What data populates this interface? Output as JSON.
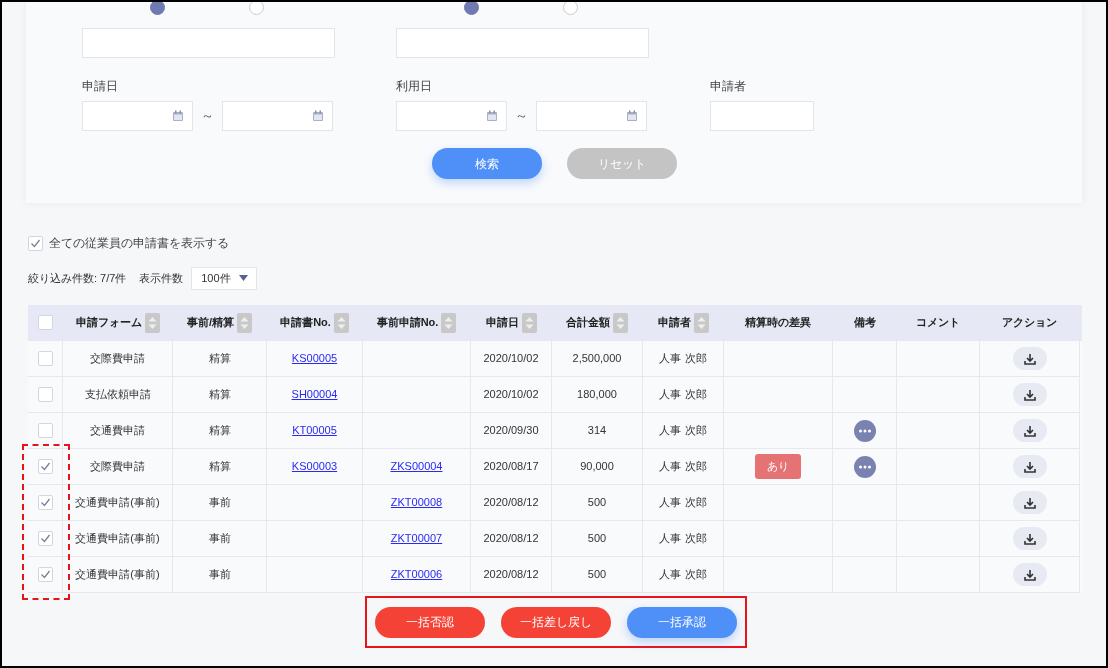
{
  "filters": {
    "number_fields": [
      {
        "radios": [
          {
            "selected": true
          },
          {
            "selected": false
          }
        ]
      },
      {
        "radios": [
          {
            "selected": true
          },
          {
            "selected": false
          }
        ]
      }
    ],
    "date_ranges": [
      {
        "label": "申請日",
        "separator": "～"
      },
      {
        "label": "利用日",
        "separator": "～"
      }
    ],
    "applicant": {
      "label": "申請者"
    },
    "buttons": [
      {
        "label": "検索",
        "kind": "primary"
      },
      {
        "label": "リセット",
        "kind": "secondary"
      }
    ]
  },
  "show_all": {
    "label": "全ての従業員の申請書を表示する",
    "checked": true
  },
  "count_text": "絞り込み件数: 7/7件",
  "page_size": {
    "label": "表示件数",
    "value": "100件"
  },
  "table": {
    "select_all": {
      "checked": false
    },
    "columns": [
      {
        "label": "申請フォーム",
        "sortable": true
      },
      {
        "label": "事前/精算",
        "sortable": true
      },
      {
        "label": "申請書No.",
        "sortable": true
      },
      {
        "label": "事前申請No.",
        "sortable": true
      },
      {
        "label": "申請日",
        "sortable": true
      },
      {
        "label": "合計金額",
        "sortable": true
      },
      {
        "label": "申請者",
        "sortable": true
      },
      {
        "label": "精算時の差異",
        "sortable": false
      },
      {
        "label": "備考",
        "sortable": false
      },
      {
        "label": "コメント",
        "sortable": false
      },
      {
        "label": "アクション",
        "sortable": false
      }
    ],
    "rows": [
      {
        "checked": false,
        "form": "交際費申請",
        "type": "精算",
        "no": "KS00005",
        "pre_no": "",
        "date": "2020/10/02",
        "amount": "2,500,000",
        "applicant": "人事 次郎",
        "diff": "",
        "note": false
      },
      {
        "checked": false,
        "form": "支払依頼申請",
        "type": "精算",
        "no": "SH00004",
        "pre_no": "",
        "date": "2020/10/02",
        "amount": "180,000",
        "applicant": "人事 次郎",
        "diff": "",
        "note": false
      },
      {
        "checked": false,
        "form": "交通費申請",
        "type": "精算",
        "no": "KT00005",
        "pre_no": "",
        "date": "2020/09/30",
        "amount": "314",
        "applicant": "人事 次郎",
        "diff": "",
        "note": true
      },
      {
        "checked": true,
        "form": "交際費申請",
        "type": "精算",
        "no": "KS00003",
        "pre_no": "ZKS00004",
        "date": "2020/08/17",
        "amount": "90,000",
        "applicant": "人事 次郎",
        "diff": "あり",
        "note": true
      },
      {
        "checked": true,
        "form": "交通費申請(事前)",
        "type": "事前",
        "no": "",
        "pre_no": "ZKT00008",
        "date": "2020/08/12",
        "amount": "500",
        "applicant": "人事 次郎",
        "diff": "",
        "note": false
      },
      {
        "checked": true,
        "form": "交通費申請(事前)",
        "type": "事前",
        "no": "",
        "pre_no": "ZKT00007",
        "date": "2020/08/12",
        "amount": "500",
        "applicant": "人事 次郎",
        "diff": "",
        "note": false
      },
      {
        "checked": true,
        "form": "交通費申請(事前)",
        "type": "事前",
        "no": "",
        "pre_no": "ZKT00006",
        "date": "2020/08/12",
        "amount": "500",
        "applicant": "人事 次郎",
        "diff": "",
        "note": false
      }
    ]
  },
  "bulk_actions": [
    {
      "label": "一括否認",
      "kind": "danger"
    },
    {
      "label": "一括差し戻し",
      "kind": "danger"
    },
    {
      "label": "一括承認",
      "kind": "primary"
    }
  ]
}
